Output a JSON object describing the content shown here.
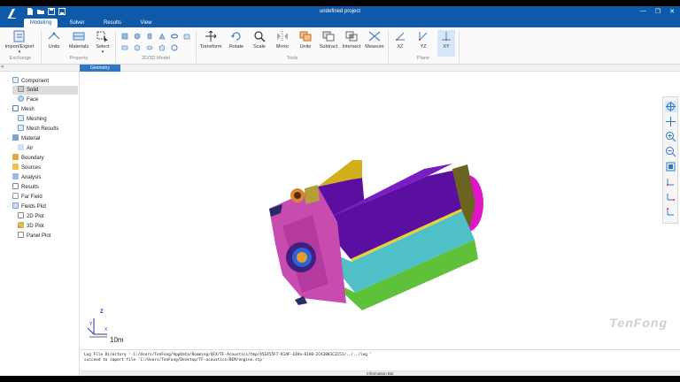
{
  "window": {
    "title": "undefined project",
    "minimize": "—",
    "maximize": "❐",
    "close": "✕"
  },
  "tabs": [
    {
      "label": "Modeling",
      "active": true
    },
    {
      "label": "Solver",
      "active": false
    },
    {
      "label": "Results",
      "active": false
    },
    {
      "label": "View",
      "active": false
    }
  ],
  "ribbon": {
    "exchange": {
      "import_export": "Import/Export",
      "group": "Exchange"
    },
    "property": {
      "units": "Units",
      "materials": "Materials",
      "select": "Select",
      "group": "Property"
    },
    "model": {
      "group": "2D/3D Model"
    },
    "tools": {
      "transform": "Transform",
      "rotate": "Rotate",
      "scale": "Scale",
      "mirror": "Mirror",
      "unite": "Unite",
      "subtract": "Subtract",
      "intersect": "Intersect",
      "measure": "Measure",
      "group": "Tools"
    },
    "plane": {
      "xz": "XZ",
      "yz": "YZ",
      "xy": "XY",
      "group": "Plane"
    }
  },
  "doc_tab": "Geometry",
  "tree": {
    "component": "Component",
    "solid": "Solid",
    "face": "Face",
    "mesh": "Mesh",
    "meshing": "Meshing",
    "mesh_results": "Mesh Results",
    "material": "Material",
    "air": "Air",
    "boundary": "Boundary",
    "sources": "Sources",
    "analysis": "Analysis",
    "results": "Results",
    "far_field": "Far Field",
    "fields_plot": "Fields Plot",
    "plot2d": "2D Plot",
    "plot3d": "3D Plot",
    "panel_plot": "Panel Plot"
  },
  "viewport": {
    "watermark": "TenFong",
    "axis_z": "Z",
    "axis_x": "X",
    "axis_y": "Y",
    "scale": "10m"
  },
  "log": {
    "line1": "Log File Directory ' C:/Users/TenFong/AppData/Roaming/QFX/TF-Acoustics/tmp/45E455F7-814F-439a-81A0-2CA3883C2C51/../../log '",
    "line2": "succeed to import file 'C:/Users/TenFong/Desktop/TF-acoustics/BEM/engine.stp'"
  },
  "info_bar": "Information Bar",
  "colors": {
    "brand": "#0f5aa8",
    "accent": "#2f77c3"
  }
}
